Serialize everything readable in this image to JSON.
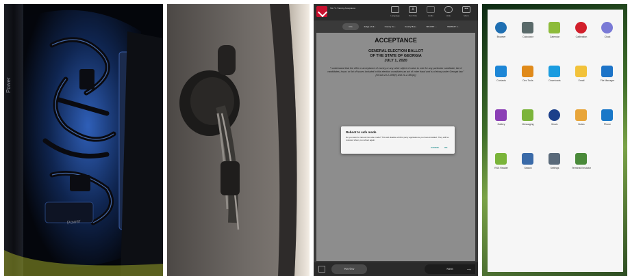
{
  "photo1": {
    "side_label_top": "Power",
    "side_label_bottom": "Power",
    "colors": {
      "glow": "#3b7fe0",
      "case": "#0a0c12"
    }
  },
  "photo2": {
    "colors": {
      "wall": "#6e6a66",
      "edge": "#d9d2c8"
    }
  },
  "ballot": {
    "app_title": "SG 7.6 Training Acceptance",
    "toolbar": [
      {
        "label": "Language"
      },
      {
        "label": "Text Size"
      },
      {
        "label": "Audio"
      },
      {
        "label": "Hide"
      },
      {
        "label": "Menu"
      }
    ],
    "tabs": [
      {
        "label": "Info",
        "active": true
      },
      {
        "label": "Judge of Hi..."
      },
      {
        "label": "County Co..."
      },
      {
        "label": "County Boa..."
      },
      {
        "label": "SPLOST ..."
      },
      {
        "label": "DEMOAT 1..."
      }
    ],
    "heading": "ACCEPTANCE",
    "subheading_lines": [
      "GENERAL ELECTION BALLOT",
      "OF THE STATE OF GEORGIA",
      "JULY 1, 2020"
    ],
    "oath": "\"I understand that the offer or acceptance of money or any other object of value to vote for any particular candidate, list of candidates, issue, or list of issues included in this election constitutes an act of voter fraud and is a felony under Georgia law.\" [OCGA 21-2-285(h) and 21-2-383(a)]",
    "dialog": {
      "title": "Reboot to safe mode",
      "body": "Do you want to reboot into safe mode? This will disable all third party applications you have installed. They will be restored when you reboot again.",
      "cancel": "CANCEL",
      "ok": "OK"
    },
    "review_label": "Review",
    "next_label": "Next",
    "colors": {
      "brand": "#c8102e",
      "accent": "#1a8a8a"
    }
  },
  "launcher": {
    "apps": [
      {
        "label": "Browser",
        "icon": "globe-icon",
        "color": "#1f6fb2"
      },
      {
        "label": "Calculator",
        "icon": "calculator-icon",
        "color": "#5a6a6a"
      },
      {
        "label": "Calendar",
        "icon": "calendar-icon",
        "color": "#8dbb3a"
      },
      {
        "label": "Calibration",
        "icon": "target-icon",
        "color": "#d21f2b"
      },
      {
        "label": "Clock",
        "icon": "clock-icon",
        "color": "#7a7ad6"
      },
      {
        "label": "Contacts",
        "icon": "contacts-icon",
        "color": "#1d86d6"
      },
      {
        "label": "Dev Tools",
        "icon": "gears-icon",
        "color": "#e08a1a"
      },
      {
        "label": "Downloads",
        "icon": "download-icon",
        "color": "#1a9ce0"
      },
      {
        "label": "Email",
        "icon": "email-icon",
        "color": "#f2c23a"
      },
      {
        "label": "File Manager",
        "icon": "folder-icon",
        "color": "#1d74c8"
      },
      {
        "label": "Gallery",
        "icon": "gallery-icon",
        "color": "#8b3fb5"
      },
      {
        "label": "Messaging",
        "icon": "message-icon",
        "color": "#7bb43a"
      },
      {
        "label": "Music",
        "icon": "music-icon",
        "color": "#1c3f8a"
      },
      {
        "label": "Notes",
        "icon": "notes-icon",
        "color": "#e8a53a"
      },
      {
        "label": "Phone",
        "icon": "phone-icon",
        "color": "#1a78c8"
      },
      {
        "label": "RSS Reader",
        "icon": "android-icon",
        "color": "#7ab43a"
      },
      {
        "label": "Search",
        "icon": "search-icon",
        "color": "#3a6aa8"
      },
      {
        "label": "Settings",
        "icon": "gear-icon",
        "color": "#5a6a7a"
      },
      {
        "label": "Terminal Emulator",
        "icon": "terminal-icon",
        "color": "#4a8a3a"
      }
    ]
  }
}
